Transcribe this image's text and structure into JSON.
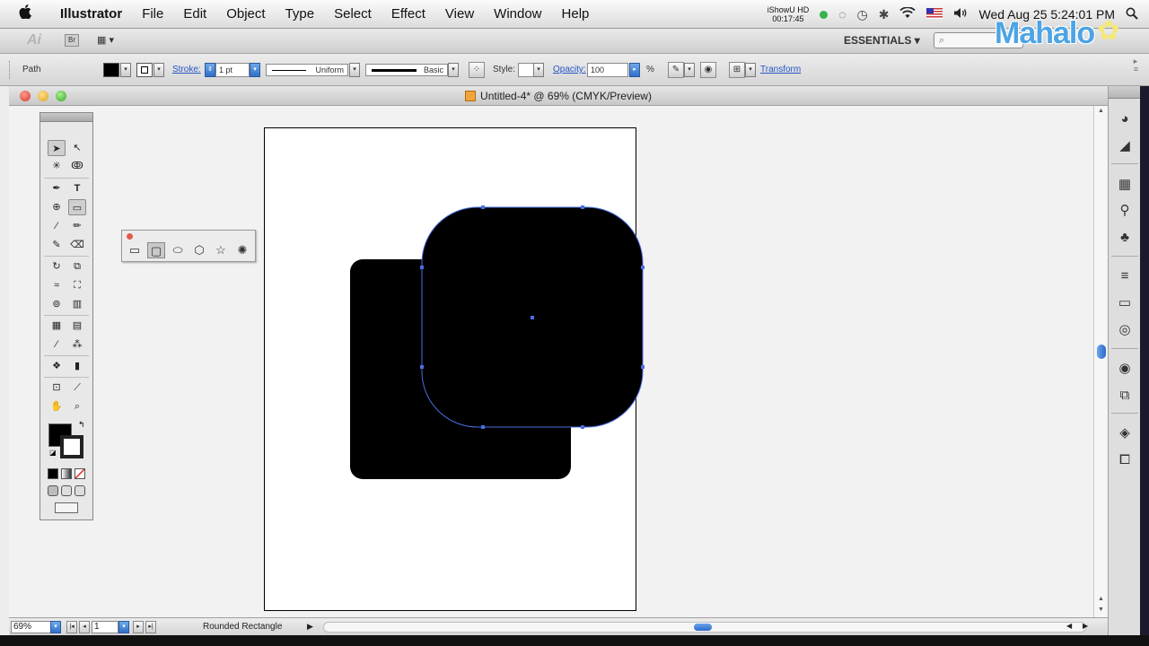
{
  "menubar": {
    "apple": "",
    "app_name": "Illustrator",
    "items": [
      "File",
      "Edit",
      "Object",
      "Type",
      "Select",
      "Effect",
      "View",
      "Window",
      "Help"
    ],
    "ishow_title": "iShowU HD",
    "ishow_time": "00:17:45",
    "clock": "Wed Aug 25  5:24:01 PM"
  },
  "appbar": {
    "logo": "Ai",
    "bridge": "Br",
    "workspace": "ESSENTIALS",
    "search_placeholder": "",
    "watermark": "Mahalo"
  },
  "control": {
    "selection_type": "Path",
    "stroke_label": "Stroke:",
    "stroke_weight": "1 pt",
    "profile_label": "Uniform",
    "brush_label": "Basic",
    "style_label": "Style:",
    "opacity_label": "Opacity:",
    "opacity_value": "100",
    "opacity_unit": "%",
    "transform_label": "Transform"
  },
  "document": {
    "title": "Untitled-4* @ 69% (CMYK/Preview)"
  },
  "statusbar": {
    "zoom": "69%",
    "page": "1",
    "current_tool": "Rounded Rectangle"
  },
  "colors": {
    "accent": "#2f6fca",
    "selection": "#4a6ee0",
    "fill": "#000000",
    "stroke": "#ffffff"
  },
  "icons": {
    "search": "search-icon",
    "wifi": "wifi-icon",
    "volume": "volume-icon"
  }
}
